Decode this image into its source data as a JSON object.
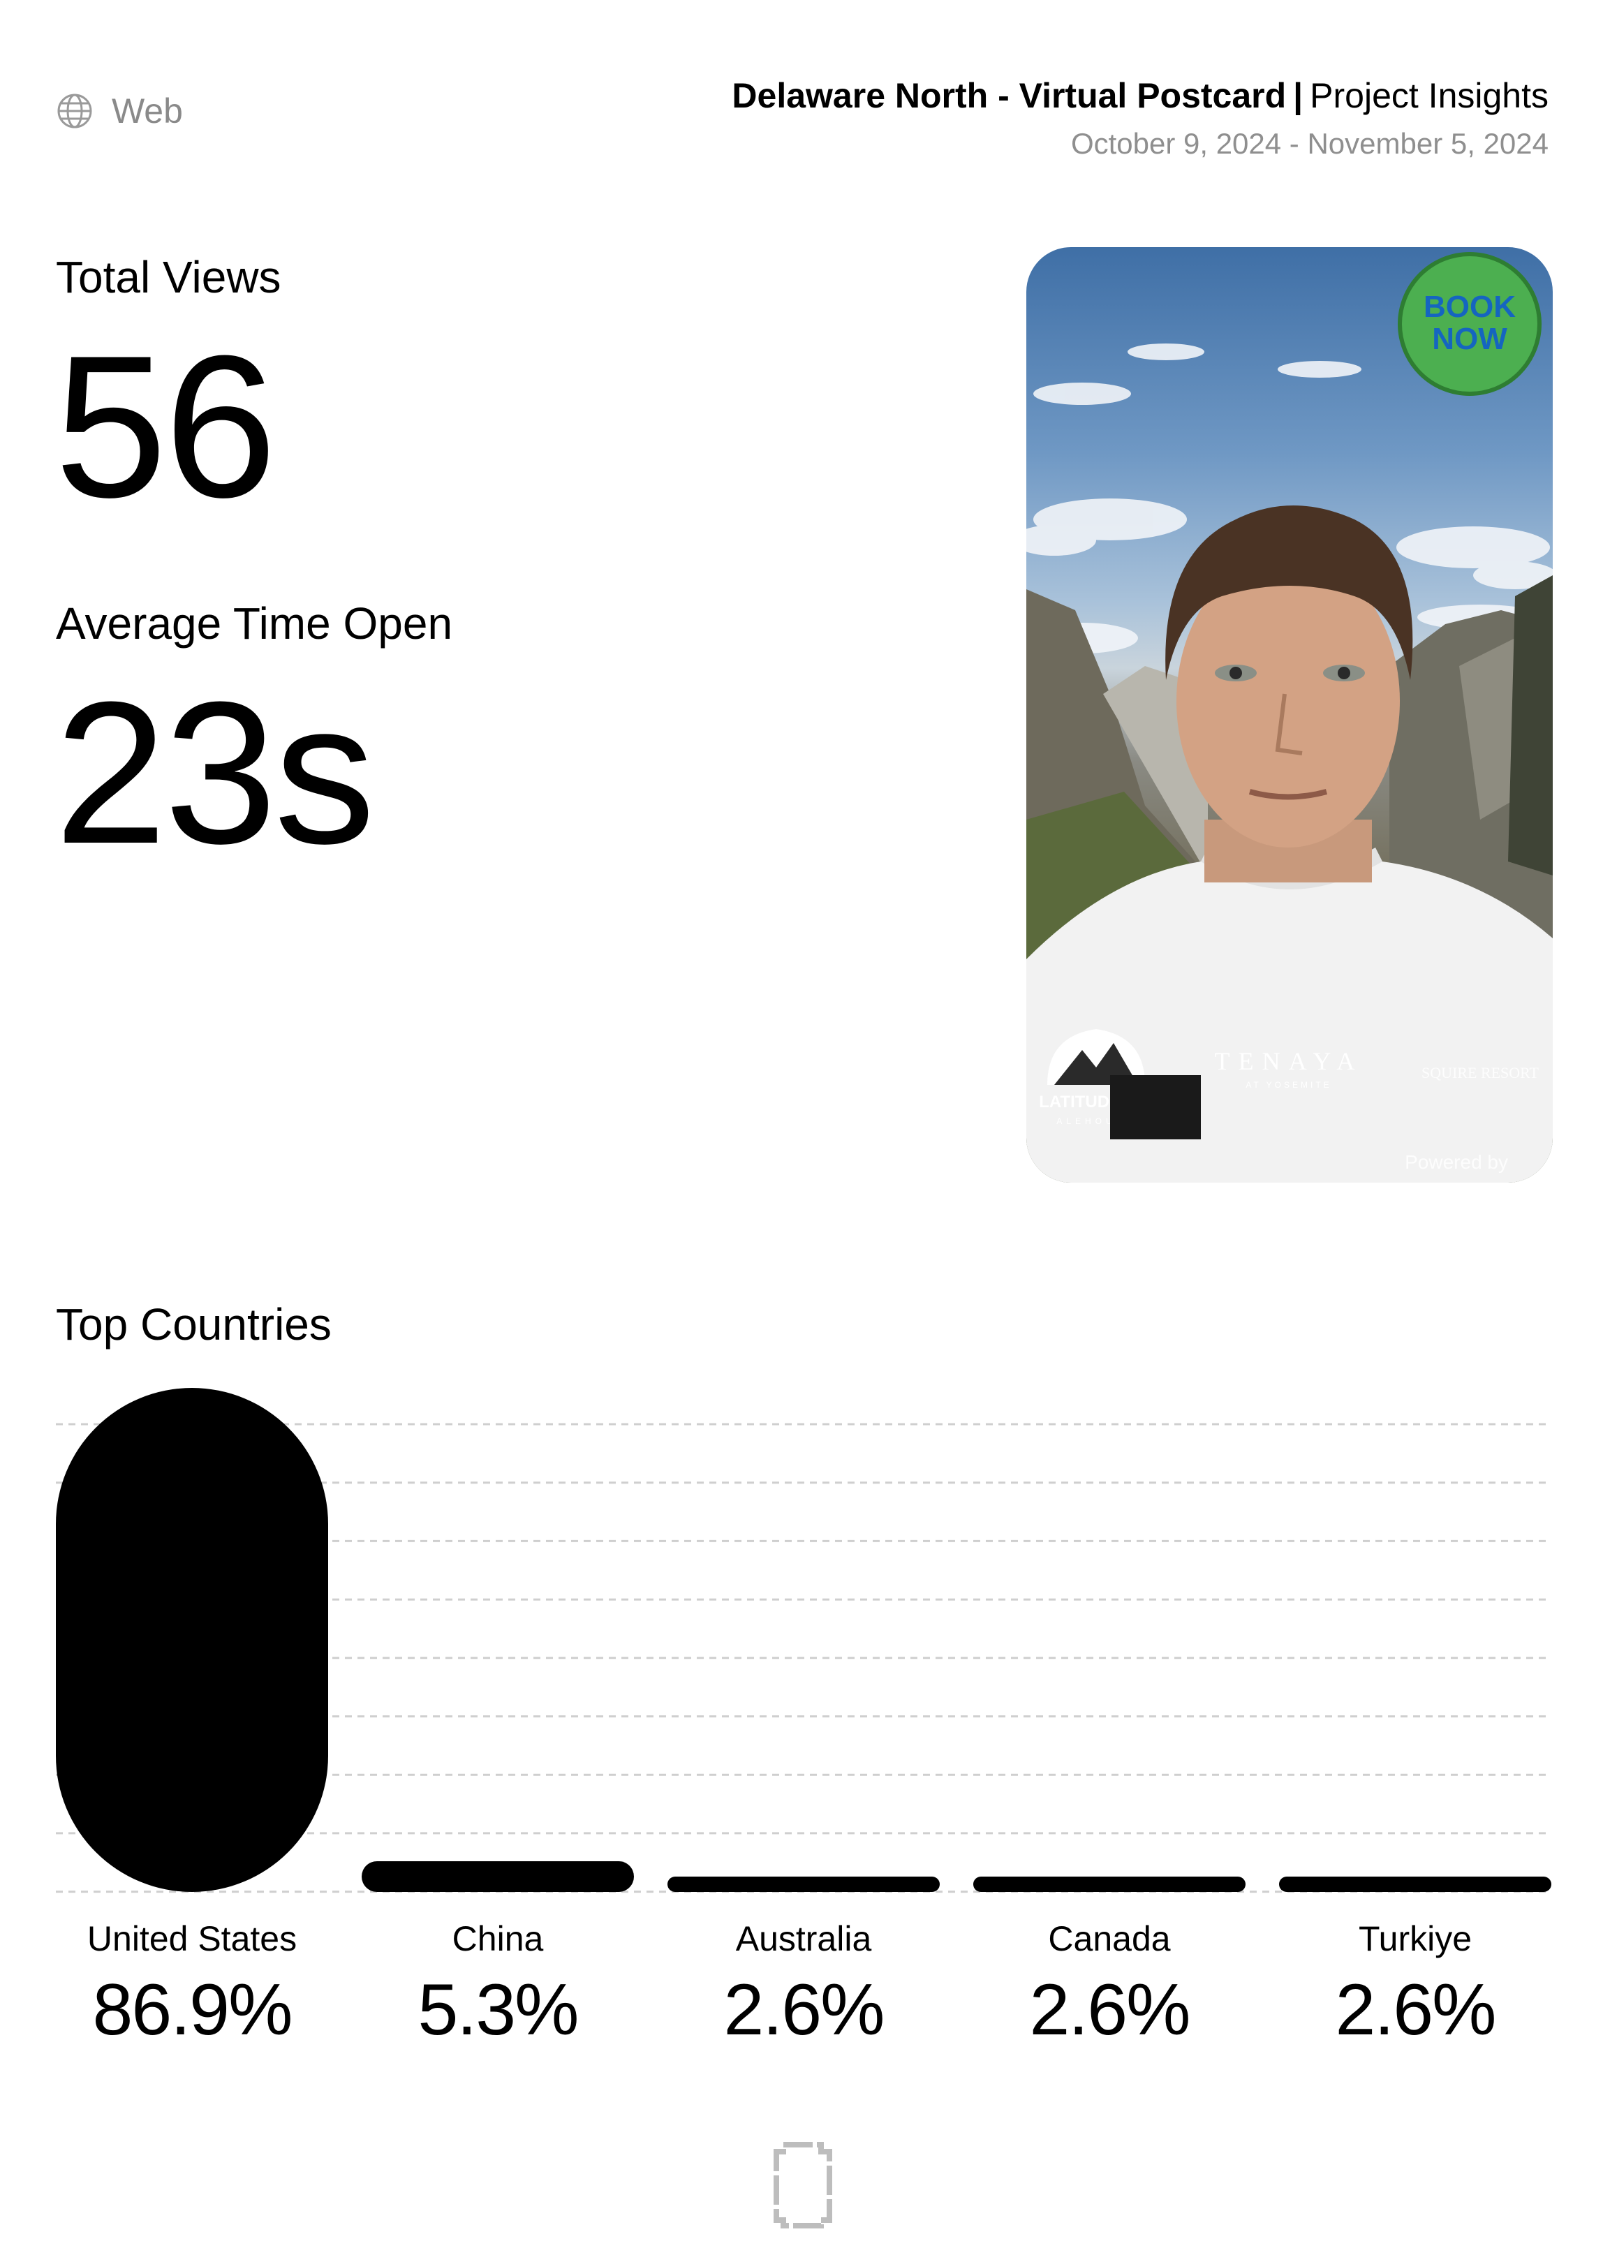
{
  "header": {
    "platform_icon": "globe-icon",
    "platform_label": "Web",
    "project_name": "Delaware North - Virtual Postcard",
    "separator": "|",
    "project_section": "Project Insights",
    "date_range": "October 9, 2024 - November 5, 2024"
  },
  "metrics": {
    "total_views_label": "Total Views",
    "total_views_value": "56",
    "avg_time_label": "Average Time Open",
    "avg_time_value": "23s"
  },
  "preview": {
    "badge_line1": "BOOK",
    "badge_line2": "NOW",
    "logo_left": "LATITUDE 105",
    "logo_left_sub": "ALEHOUSE",
    "logo_center": "TENAYA",
    "logo_center_sub": "AT YOSEMITE",
    "logo_right": "SQUIRE RESORT",
    "powered_by": "Powered by",
    "badge_color": "#4caf50",
    "badge_text_color": "#1565c0"
  },
  "chart_data": {
    "type": "bar",
    "title": "Top Countries",
    "categories": [
      "United States",
      "China",
      "Australia",
      "Canada",
      "Turkiye"
    ],
    "values": [
      86.9,
      5.3,
      2.6,
      2.6,
      2.6
    ],
    "value_labels": [
      "86.9%",
      "5.3%",
      "2.6%",
      "2.6%",
      "2.6%"
    ],
    "unit": "%",
    "ylim": [
      0,
      86.9
    ],
    "grid": true,
    "bar_color": "#000000",
    "xlabel": "",
    "ylabel": ""
  },
  "footer": {
    "icon": "phone-icon"
  }
}
